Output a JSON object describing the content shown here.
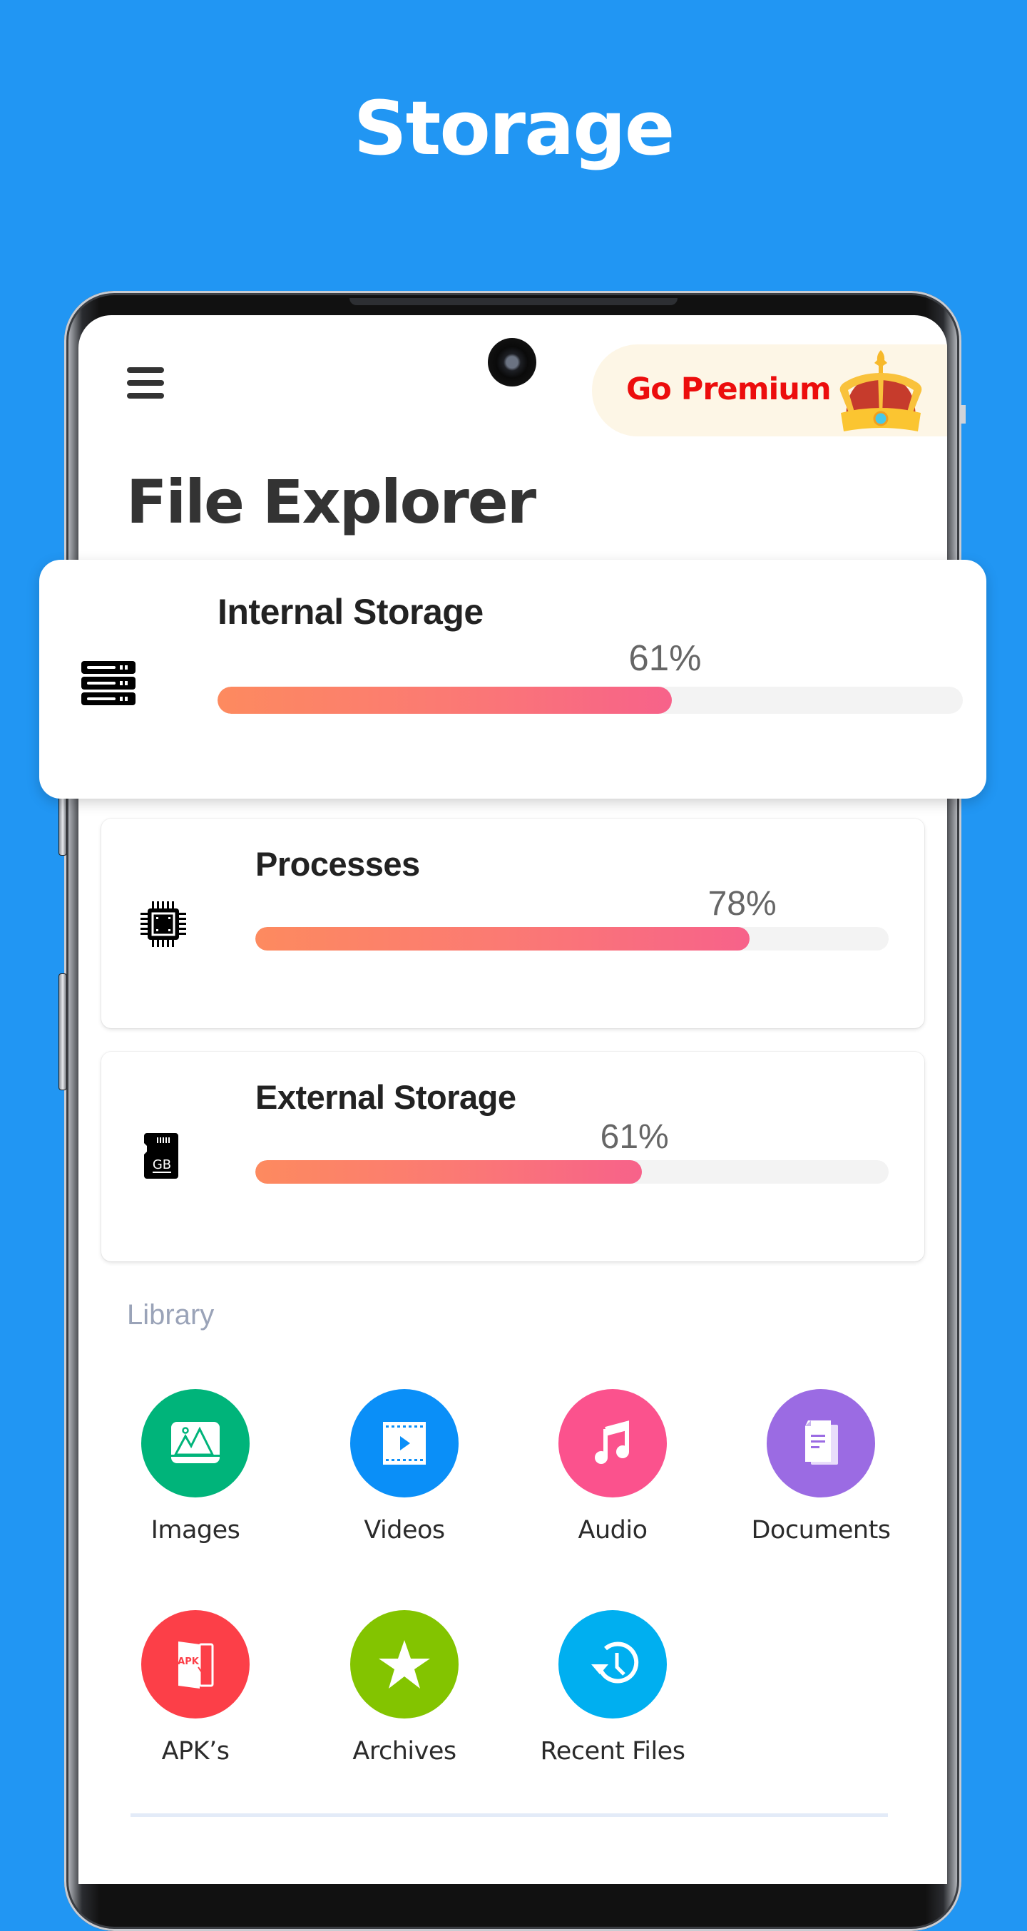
{
  "headline": "Storage",
  "app": {
    "title": "File Explorer",
    "menu_icon": "hamburger-menu-icon",
    "premium": {
      "label": "Go Premium",
      "icon": "crown-icon",
      "text_color": "#ec0d0d",
      "bg_color": "#fdf6e6"
    }
  },
  "storage_cards": [
    {
      "title": "Internal Storage",
      "percent_label": "61%",
      "percent": 61,
      "icon": "server-storage-icon"
    },
    {
      "title": "Processes",
      "percent_label": "78%",
      "percent": 78,
      "icon": "cpu-chip-icon"
    },
    {
      "title": "External Storage",
      "percent_label": "61%",
      "percent": 61,
      "icon": "sd-card-icon"
    }
  ],
  "bar_gradient": {
    "start": "#fd8a5f",
    "end": "#f7628a",
    "track": "#f3f3f3"
  },
  "library": {
    "label": "Library",
    "items": [
      {
        "label": "Images",
        "icon": "image-icon",
        "color": "#00b47a"
      },
      {
        "label": "Videos",
        "icon": "video-icon",
        "color": "#0a8ff8"
      },
      {
        "label": "Audio",
        "icon": "music-note-icon",
        "color": "#fb528d"
      },
      {
        "label": "Documents",
        "icon": "document-icon",
        "color": "#9b6be3"
      },
      {
        "label": "APK’s",
        "icon": "apk-icon",
        "color": "#fc3f48"
      },
      {
        "label": "Archives",
        "icon": "star-icon",
        "color": "#83c400"
      },
      {
        "label": "Recent Files",
        "icon": "history-icon",
        "color": "#00aff0"
      }
    ]
  },
  "background_color": "#2196F3"
}
